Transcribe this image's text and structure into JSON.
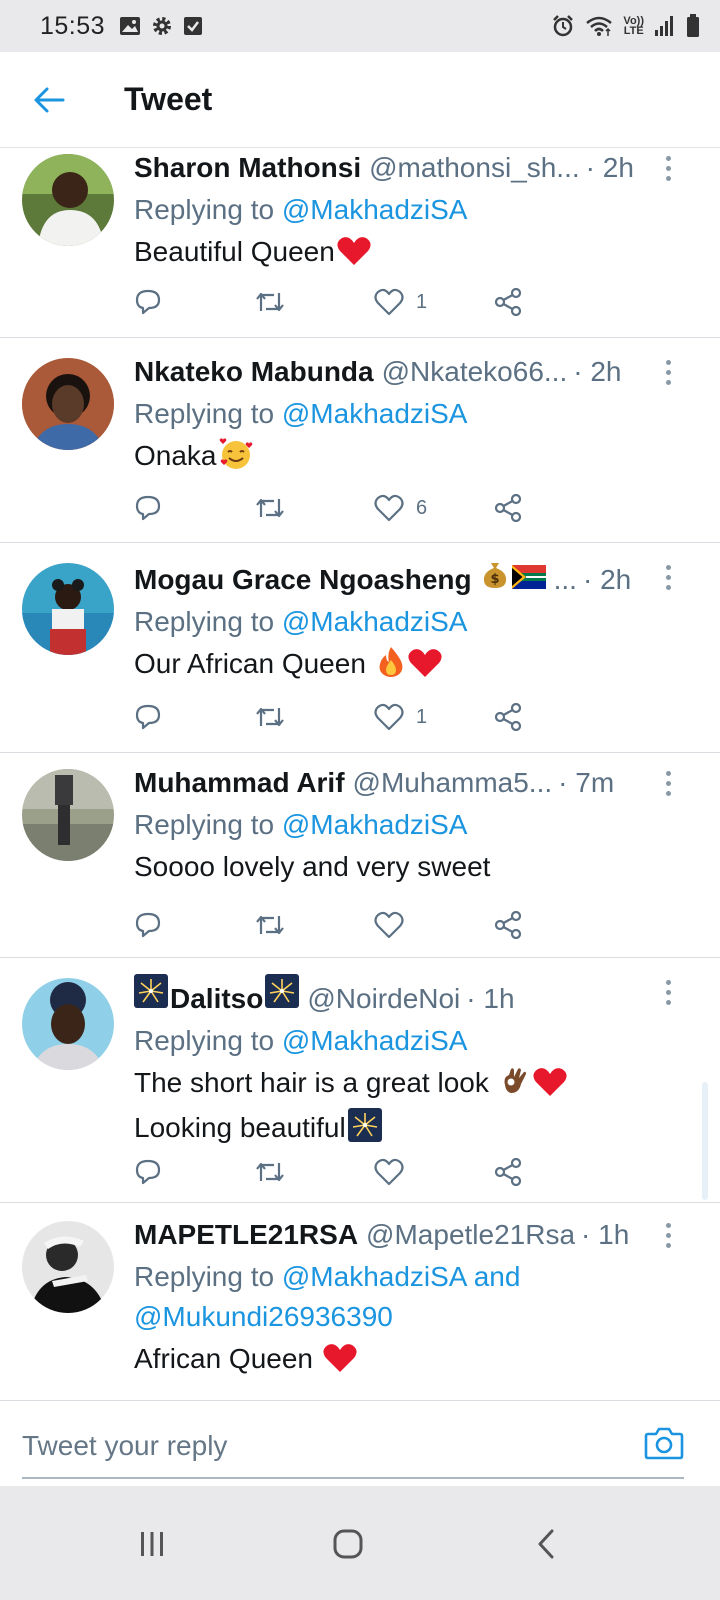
{
  "status_bar": {
    "time": "15:53",
    "left_icons": [
      "image-icon",
      "settings-icon",
      "checkbox-icon"
    ],
    "right_icons": [
      "alarm-icon",
      "wifi-icon",
      "volte-icon",
      "signal-icon",
      "battery-icon"
    ],
    "volte_label_top": "Vo))",
    "volte_label_bottom": "LTE"
  },
  "header": {
    "title": "Tweet"
  },
  "colors": {
    "accent": "#1b95e0",
    "like_red": "#e0245e",
    "muted": "#5b7083"
  },
  "tweets": [
    {
      "display_name": "Sharon Mathonsi",
      "handle": "@mathonsi_sh...",
      "time": "· 2h",
      "reply_prefix": "Replying to",
      "mentions": [
        "@MakhadziSA"
      ],
      "text_lines": [
        "Beautiful Queen"
      ],
      "emojis": [
        "red-heart"
      ],
      "likes": "1"
    },
    {
      "display_name": "Nkateko Mabunda",
      "handle": "@Nkateko66...",
      "time": "· 2h",
      "reply_prefix": "Replying to",
      "mentions": [
        "@MakhadziSA"
      ],
      "text_lines": [
        "Onaka"
      ],
      "emojis": [
        "smiling-face-with-hearts"
      ],
      "likes": "6"
    },
    {
      "display_name": "Mogau Grace Ngoasheng",
      "handle": "...",
      "time": "· 2h",
      "reply_prefix": "Replying to",
      "mentions": [
        "@MakhadziSA"
      ],
      "text_lines": [
        "Our African Queen "
      ],
      "emojis": [
        "money-bag",
        "south-africa-flag",
        "fire",
        "red-heart"
      ],
      "likes": "1"
    },
    {
      "display_name": "Muhammad Arif",
      "handle": "@Muhamma5...",
      "time": "· 7m",
      "reply_prefix": "Replying to",
      "mentions": [
        "@MakhadziSA"
      ],
      "text_lines": [
        "Soooo lovely and very sweet"
      ],
      "emojis": [],
      "likes": ""
    },
    {
      "display_name": "Dalitso",
      "handle": "@NoirdeNoi",
      "time": "· 1h",
      "reply_prefix": "Replying to",
      "mentions": [
        "@MakhadziSA"
      ],
      "text_lines": [
        "The short hair is a great look ",
        "Looking beautiful"
      ],
      "emojis": [
        "fireworks",
        "ok-hand",
        "red-heart"
      ],
      "likes": ""
    },
    {
      "display_name": "MAPETLE21RSA",
      "handle": "@Mapetle21Rsa",
      "time": "· 1h",
      "reply_prefix": "Replying to",
      "mentions": [
        "@MakhadziSA and",
        "@Mukundi26936390"
      ],
      "text_lines": [
        "African Queen "
      ],
      "emojis": [
        "red-heart"
      ],
      "likes": ""
    }
  ],
  "reply_box": {
    "placeholder": "Tweet your reply",
    "camera_icon": "camera-icon"
  },
  "nav_bar": {
    "buttons": [
      "recent-apps-icon",
      "home-icon",
      "back-icon"
    ]
  }
}
